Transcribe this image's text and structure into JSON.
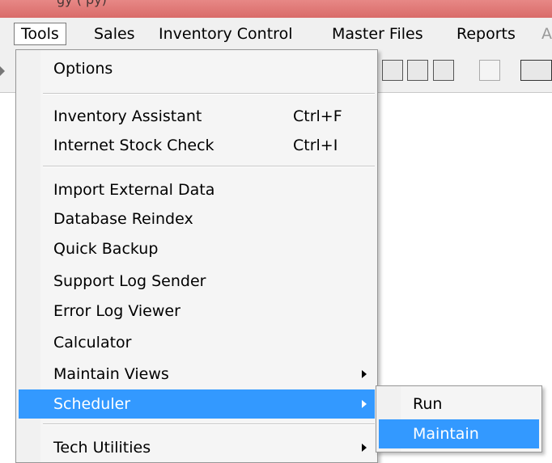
{
  "title_fragment": "gy  (          py)",
  "menubar": {
    "items": [
      "Tools",
      "Sales",
      "Inventory Control",
      "Master Files",
      "Reports",
      "A"
    ]
  },
  "tools_menu": {
    "options": "Options",
    "inventory_assistant": "Inventory Assistant",
    "inventory_assistant_shortcut": "Ctrl+F",
    "internet_stock_check": "Internet Stock Check",
    "internet_stock_check_shortcut": "Ctrl+I",
    "import_external_data": "Import External Data",
    "database_reindex": "Database Reindex",
    "quick_backup": "Quick Backup",
    "support_log_sender": "Support Log Sender",
    "error_log_viewer": "Error Log Viewer",
    "calculator": "Calculator",
    "maintain_views": "Maintain Views",
    "scheduler": "Scheduler",
    "tech_utilities": "Tech Utilities"
  },
  "scheduler_submenu": {
    "run": "Run",
    "maintain": "Maintain"
  },
  "colors": {
    "highlight": "#3399ff",
    "titlebar": "#d96b69"
  }
}
